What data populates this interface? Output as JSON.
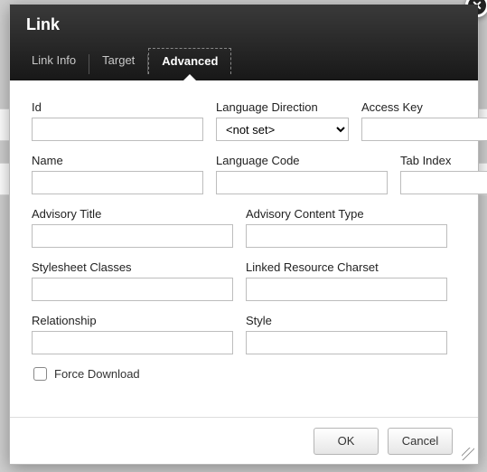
{
  "dialog": {
    "title": "Link",
    "close_label": "✕"
  },
  "tabs": {
    "items": [
      {
        "label": "Link Info"
      },
      {
        "label": "Target"
      },
      {
        "label": "Advanced"
      }
    ],
    "active_index": 2
  },
  "fields": {
    "id": {
      "label": "Id",
      "value": ""
    },
    "langdir": {
      "label": "Language Direction",
      "value": "<not set>"
    },
    "accesskey": {
      "label": "Access Key",
      "value": ""
    },
    "name": {
      "label": "Name",
      "value": ""
    },
    "langcode": {
      "label": "Language Code",
      "value": ""
    },
    "tabindex": {
      "label": "Tab Index",
      "value": ""
    },
    "advtitle": {
      "label": "Advisory Title",
      "value": ""
    },
    "advctype": {
      "label": "Advisory Content Type",
      "value": ""
    },
    "classes": {
      "label": "Stylesheet Classes",
      "value": ""
    },
    "charset": {
      "label": "Linked Resource Charset",
      "value": ""
    },
    "rel": {
      "label": "Relationship",
      "value": ""
    },
    "style": {
      "label": "Style",
      "value": ""
    }
  },
  "checkbox": {
    "force_download": {
      "label": "Force Download",
      "checked": false
    }
  },
  "buttons": {
    "ok": "OK",
    "cancel": "Cancel"
  }
}
